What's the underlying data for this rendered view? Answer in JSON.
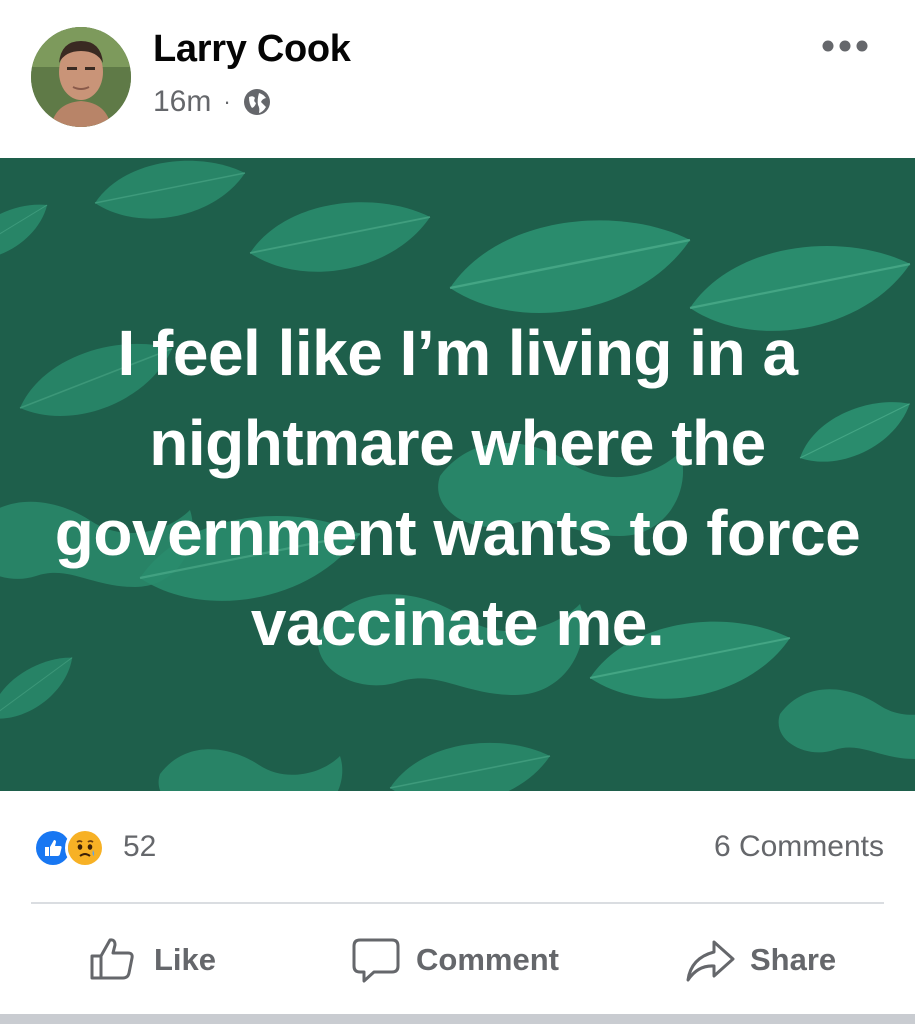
{
  "post": {
    "author": "Larry Cook",
    "time": "16m",
    "separator": "·",
    "privacy_icon": "globe-icon",
    "more_icon": "more-horizontal-icon",
    "background_color": "#1e5f4b",
    "leaf_color": "#2a8c6d",
    "text": "I feel like I’m living in a nightmare where the government wants to force vaccinate me."
  },
  "reactions": {
    "icons": [
      "like-reaction-icon",
      "sad-reaction-icon"
    ],
    "count": "52",
    "comments": "6 Comments"
  },
  "actions": {
    "like": "Like",
    "comment": "Comment",
    "share": "Share"
  },
  "colors": {
    "like_blue": "#1877f2",
    "secondary_text": "#65676b",
    "sad_yellow": "#f7b125"
  }
}
